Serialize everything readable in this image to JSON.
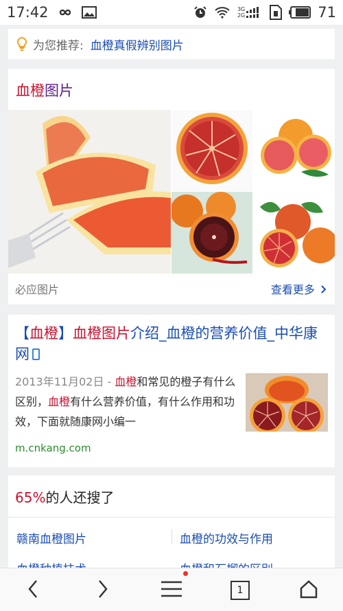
{
  "status_bar": {
    "time": "17:42",
    "battery": "71",
    "net_top": "3G",
    "net_bottom": "2G",
    "icons": [
      "infinity-icon",
      "image-icon",
      "alarm-icon",
      "wifi-icon",
      "signal-icon",
      "sim-icon",
      "battery-icon"
    ]
  },
  "recommend": {
    "label": "为您推荐:",
    "link": "血橙真假辨别图片",
    "icon": "lightbulb-icon",
    "icon_color": "#f0a020"
  },
  "image_card": {
    "title_red": "血橙",
    "title_rest": "图片",
    "footer_source": "必应图片",
    "footer_more": "查看更多",
    "more_icon": "chevron-right-icon"
  },
  "result": {
    "title_bracket_open": "【",
    "title_kw": "血橙",
    "title_bracket_close": "】",
    "title_kw2": "血橙图片",
    "title_rest": "介绍_血橙的营养价值_中华康网",
    "snippet_date": "2013年11月02日 -",
    "snippet_kw1": "血橙",
    "snippet_p1": "和常见的橙子有什么区别，",
    "snippet_kw2": "血橙",
    "snippet_p2": "有什么营养价值，有什么作用和功效，下面就随康网小编一",
    "url": "m.cnkang.com",
    "mobile_icon": "phone-icon"
  },
  "also_searched": {
    "percent": "65%",
    "title_rest": "的人还搜了",
    "items": [
      "赣南血橙图片",
      "血橙的功效与作用",
      "血橙种植技术",
      "血橙和石榴的区别"
    ]
  },
  "bottom_nav": {
    "tab_count": "1",
    "icons": [
      "back-icon",
      "forward-icon",
      "menu-icon",
      "tabs-icon",
      "home-icon"
    ],
    "notify_color": "#e8332b"
  },
  "colors": {
    "link_blue": "#1a4db3",
    "keyword_red": "#c8102e",
    "url_green": "#2e8b2e"
  }
}
